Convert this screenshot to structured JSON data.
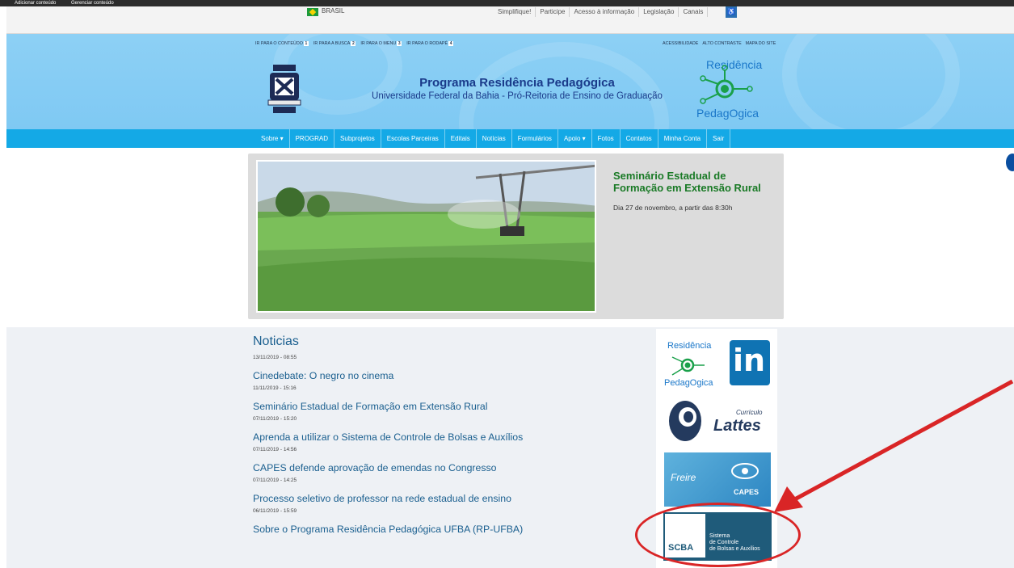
{
  "admin": {
    "add": "Adicionar conteúdo",
    "manage": "Gerenciar conteúdo"
  },
  "govbar": {
    "country": "BRASIL",
    "links": [
      "Simplifique!",
      "Participe",
      "Acesso à informação",
      "Legislação",
      "Canais"
    ]
  },
  "accessibility": {
    "left": [
      {
        "text": "IR PARA O CONTEÚDO",
        "key": "1"
      },
      {
        "text": "IR PARA A BUSCA",
        "key": "2"
      },
      {
        "text": "IR PARA O MENU",
        "key": "3"
      },
      {
        "text": "IR PARA O RODAPÉ",
        "key": "4"
      }
    ],
    "right": [
      "ACESSIBILIDADE",
      "ALTO CONTRASTE",
      "MAPA DO SITE"
    ]
  },
  "header": {
    "title": "Programa Residência Pedagógica",
    "subtitle": "Universidade Federal da Bahia - Pró-Reitoria de Ensino de Graduação",
    "logo_top": "Residência",
    "logo_bottom": "PedagOgica"
  },
  "nav": [
    "Sobre ▾",
    "PROGRAD",
    "Subprojetos",
    "Escolas Parceiras",
    "Editais",
    "Notícias",
    "Formulários",
    "Apoio ▾",
    "Fotos",
    "Contatos",
    "Minha Conta",
    "Sair"
  ],
  "banner": {
    "title": "Seminário Estadual de Formação em Extensão Rural",
    "subtitle": "Dia 27 de novembro, a partir das 8:30h"
  },
  "news": {
    "heading": "Noticias",
    "first_date": "13/11/2019 - 08:55",
    "items": [
      {
        "title": "Cinedebate: O negro no cinema",
        "date": "11/11/2019 - 15:16"
      },
      {
        "title": "Seminário Estadual de Formação em Extensão Rural",
        "date": "07/11/2019 - 15:20"
      },
      {
        "title": "Aprenda a utilizar o Sistema de Controle de Bolsas e Auxílios",
        "date": "07/11/2019 - 14:56"
      },
      {
        "title": "CAPES defende aprovação de emendas no Congresso",
        "date": "07/11/2019 - 14:25"
      },
      {
        "title": "Processo seletivo de professor na rede estadual de ensino",
        "date": "06/11/2019 - 15:59"
      },
      {
        "title": "Sobre o Programa Residência Pedagógica UFBA (RP-UFBA)",
        "date": ""
      }
    ]
  },
  "sidebar": {
    "rp_top": "Residência",
    "rp_bottom": "PedagOgica",
    "linkedin": "in",
    "lattes_small": "Currículo",
    "lattes_big": "Lattes",
    "freire": "Freire",
    "capes": "CAPES",
    "scba": "SCBA",
    "scba_lines": [
      "Sistema",
      "de Controle",
      "de Bolsas e Auxílios"
    ]
  },
  "colors": {
    "header_bg": "#8dd0f5",
    "nav_bg": "#14a9e6",
    "title_blue": "#1a3a8a",
    "banner_title": "#1a7a26",
    "link_blue": "#1a5f8f",
    "annotation_red": "#d92526"
  },
  "icons": {
    "govbar_flag": "brazil-flag-icon",
    "govbar_channel": "accessibility-channel-icon",
    "side_glyph": "partial-logo-icon",
    "annotation": "red-arrow-icon"
  }
}
